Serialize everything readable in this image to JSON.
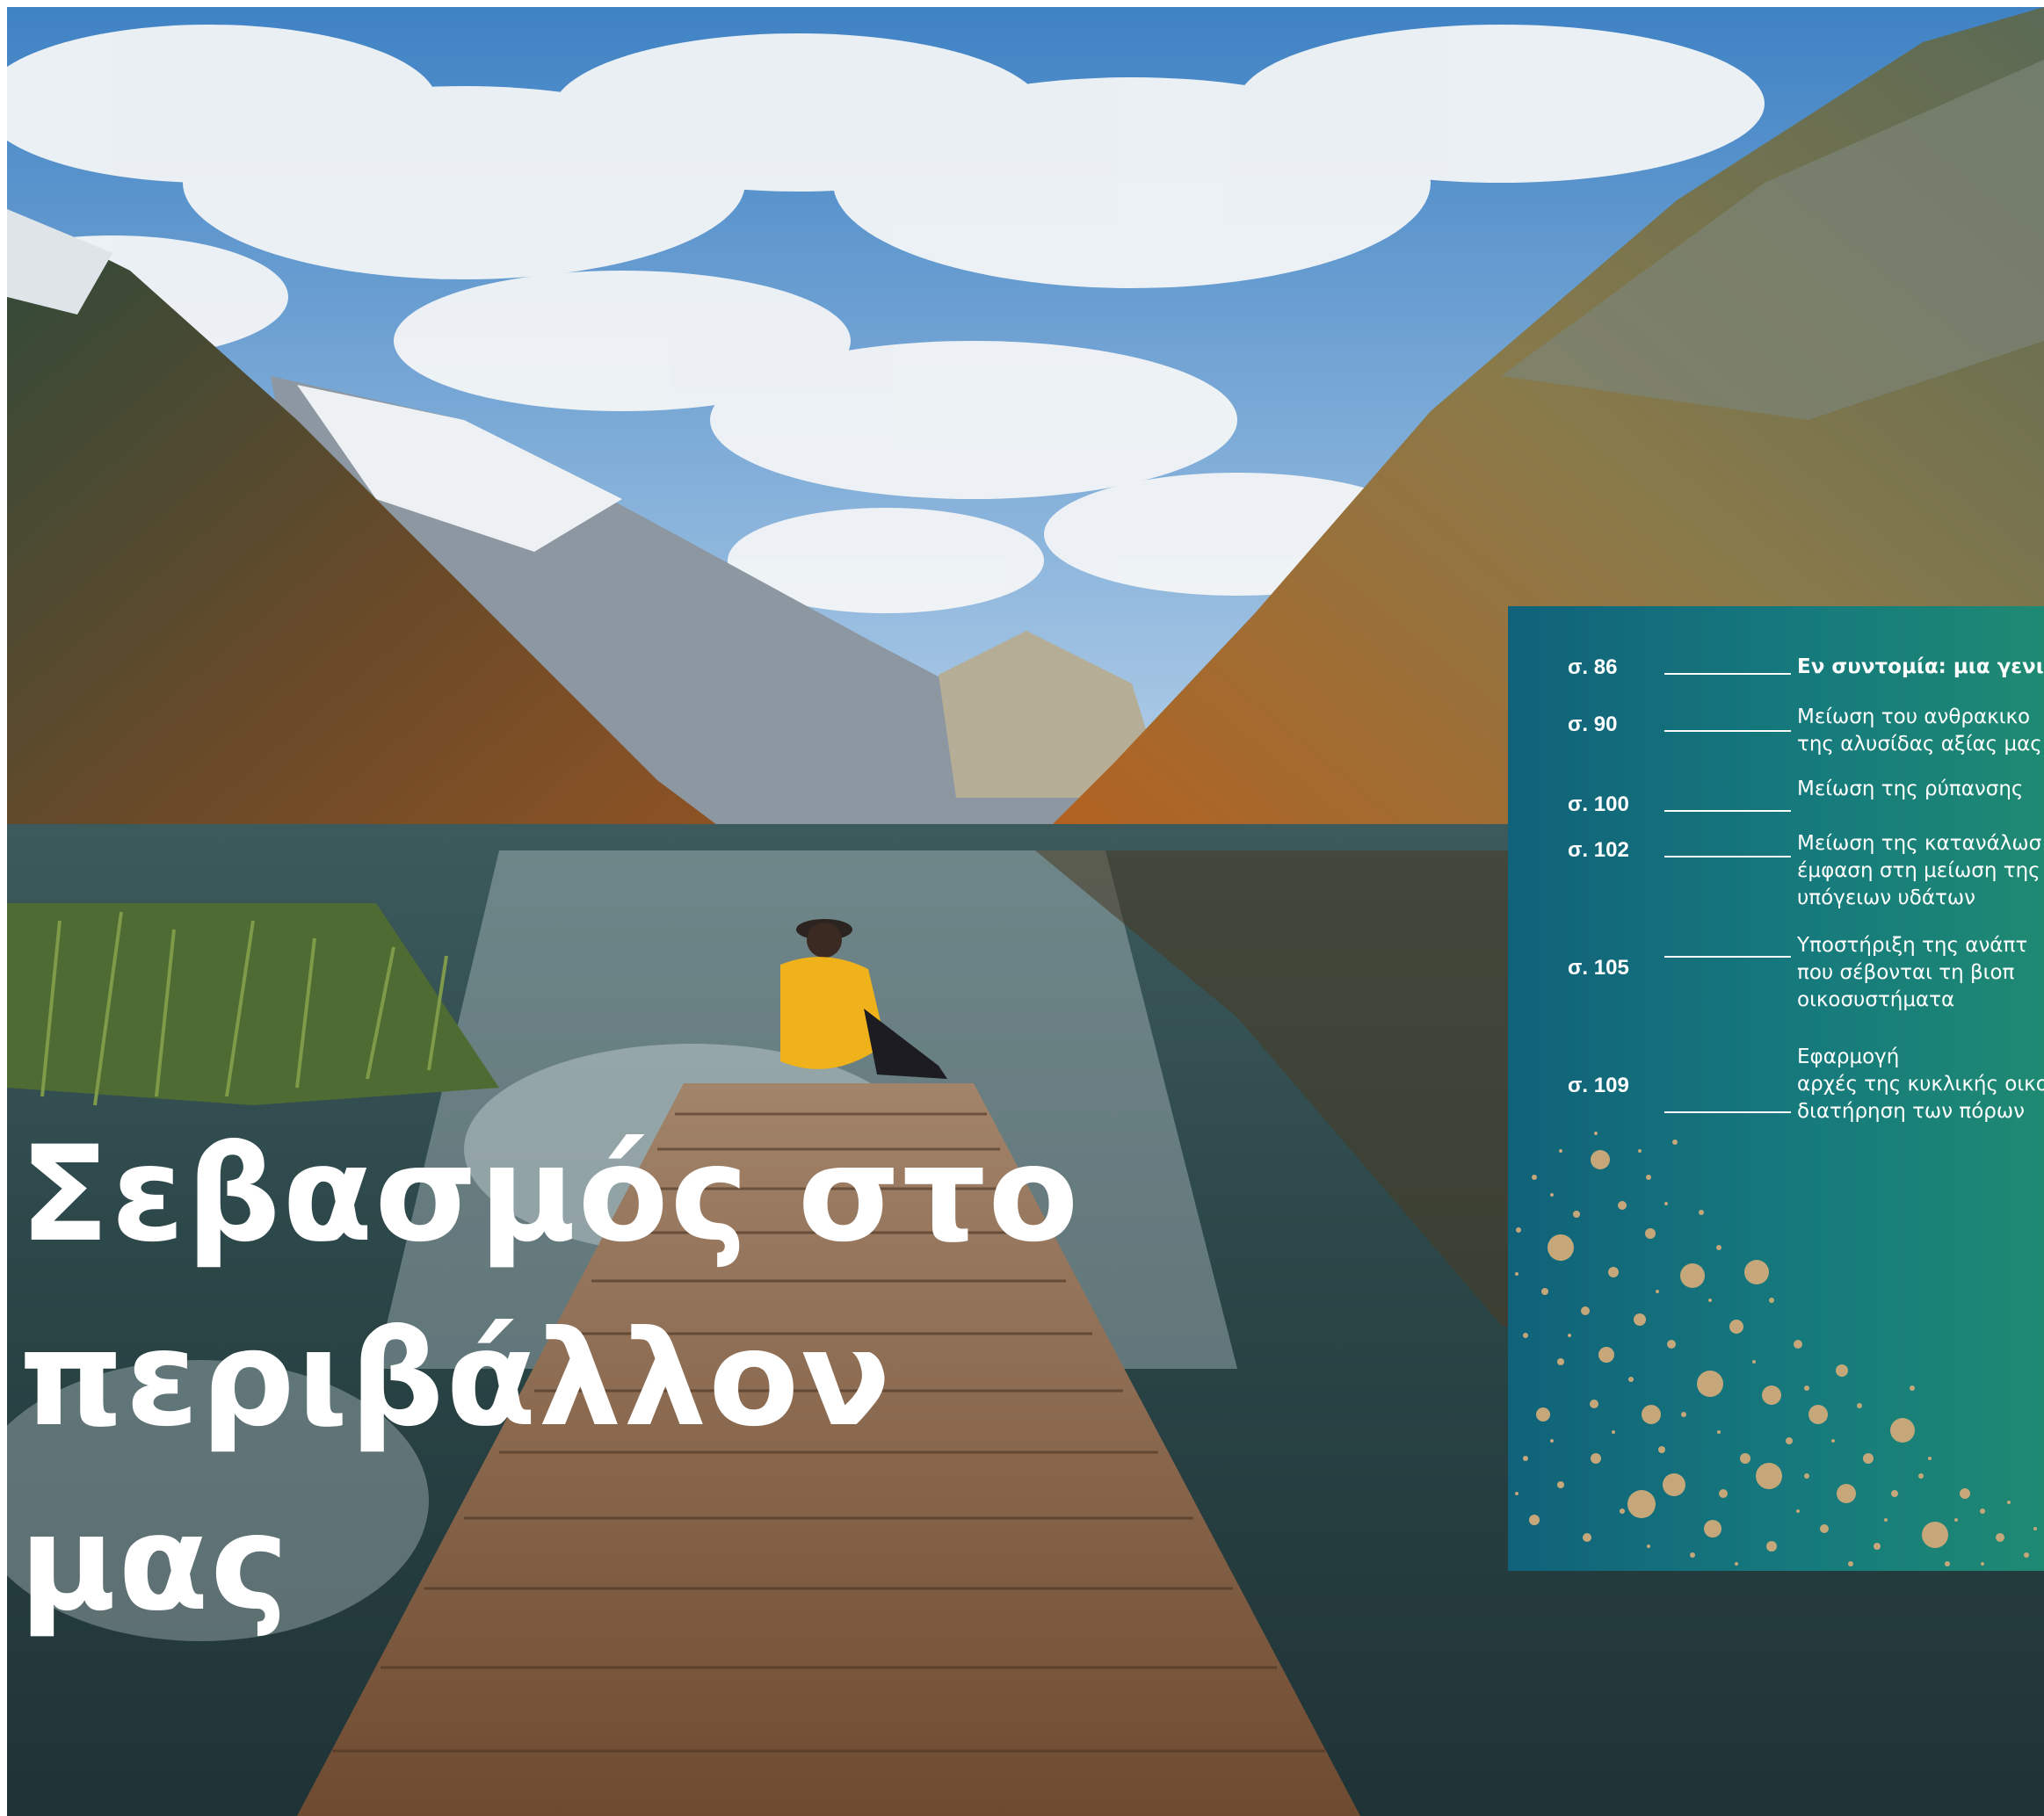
{
  "title": {
    "line1": "Σεβασμός στο",
    "line2": "περιβάλλον",
    "line3": "μας"
  },
  "photo": {
    "icons": [
      "sky",
      "clouds",
      "mountains",
      "lake",
      "reeds",
      "wooden-pier",
      "person-in-yellow-jacket"
    ],
    "colors": {
      "sky": "#4f8fc9",
      "cloud": "#f3f5f7",
      "lake": "#2d4648",
      "pier": "#8a6a4c",
      "jacket": "#f0b21a",
      "forest": "#a65c22"
    }
  },
  "toc": {
    "colors": {
      "left": "#10627a",
      "right": "#1f8a72",
      "dots": "#c6a77a"
    },
    "entries": [
      {
        "page": "σ. 86",
        "lines": [
          "Εν συντομία: μια γενι"
        ]
      },
      {
        "page": "σ. 90",
        "lines": [
          "Μείωση του ανθρακικο",
          "της αλυσίδας αξίας μας"
        ]
      },
      {
        "page": "σ. 100",
        "lines": [
          "Μείωση της ρύπανσης"
        ]
      },
      {
        "page": "σ. 102",
        "lines": [
          "Μείωση της κατανάλωσ",
          "έμφαση στη μείωση της",
          "υπόγειων υδάτων"
        ]
      },
      {
        "page": "σ. 105",
        "lines": [
          "Υποστήριξη της ανάπτ",
          "που σέβονται τη βιοπ",
          "οικοσυστήματα"
        ]
      },
      {
        "page": "σ. 109",
        "lines": [
          "Εφαρμογή",
          "αρχές της κυκλικής οικο",
          "διατήρηση των πόρων"
        ]
      }
    ]
  }
}
